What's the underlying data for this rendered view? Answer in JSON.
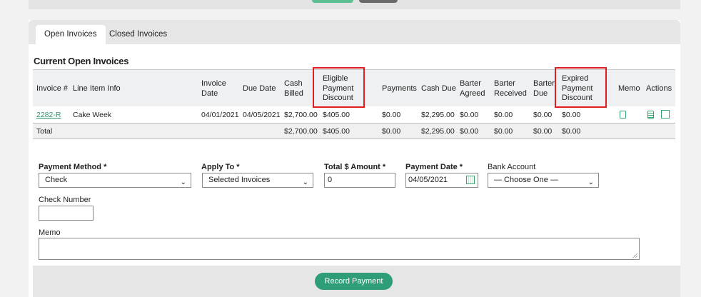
{
  "tabs": [
    {
      "label": "Open Invoices",
      "active": true
    },
    {
      "label": "Closed Invoices",
      "active": false
    }
  ],
  "section_title": "Current Open Invoices",
  "table": {
    "headers": {
      "invoice_no": "Invoice #",
      "line_item": "Line Item Info",
      "invoice_date": [
        "Invoice",
        "Date"
      ],
      "due_date": "Due Date",
      "cash_billed": [
        "Cash",
        "Billed"
      ],
      "eligible_discount": [
        "Eligible",
        "Payment",
        "Discount"
      ],
      "payments": "Payments",
      "cash_due": "Cash Due",
      "barter_agreed": [
        "Barter",
        "Agreed"
      ],
      "barter_received": [
        "Barter",
        "Received"
      ],
      "barter_due": [
        "Barter",
        "Due"
      ],
      "expired_discount": [
        "Expired",
        "Payment",
        "Discount"
      ],
      "memo": "Memo",
      "actions": "Actions"
    },
    "rows": [
      {
        "invoice_no": "2282-R",
        "line_item": "Cake Week",
        "invoice_date": "04/01/2021",
        "due_date": "04/05/2021",
        "cash_billed": "$2,700.00",
        "eligible_discount": "$405.00",
        "payments": "$0.00",
        "cash_due": "$2,295.00",
        "barter_agreed": "$0.00",
        "barter_received": "$0.00",
        "barter_due": "$0.00",
        "expired_discount": "$0.00"
      }
    ],
    "total": {
      "label": "Total",
      "cash_billed": "$2,700.00",
      "eligible_discount": "$405.00",
      "payments": "$0.00",
      "cash_due": "$2,295.00",
      "barter_agreed": "$0.00",
      "barter_received": "$0.00",
      "barter_due": "$0.00",
      "expired_discount": "$0.00"
    }
  },
  "form": {
    "payment_method": {
      "label": "Payment Method *",
      "value": "Check"
    },
    "apply_to": {
      "label": "Apply To *",
      "value": "Selected Invoices"
    },
    "total_amount": {
      "label": "Total $ Amount *",
      "value": "0"
    },
    "payment_date": {
      "label": "Payment Date *",
      "value": "04/05/2021"
    },
    "bank_account": {
      "label": "Bank Account",
      "value": "— Choose One —"
    },
    "check_number": {
      "label": "Check Number",
      "value": ""
    },
    "memo": {
      "label": "Memo",
      "value": ""
    }
  },
  "record_button": "Record Payment",
  "colors": {
    "accent": "#2f9d78",
    "highlight": "#e02020",
    "link": "#2b9a6a"
  },
  "icons": [
    "memo-icon",
    "actions-doc-icon",
    "calendar-icon",
    "chevron-down-icon"
  ]
}
